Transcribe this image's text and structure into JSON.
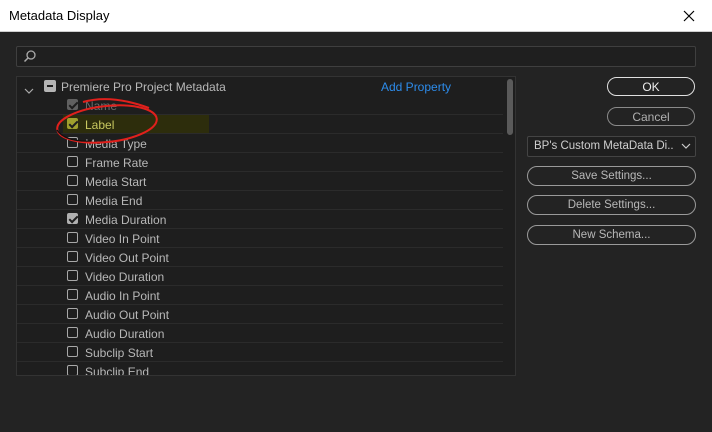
{
  "window": {
    "title": "Metadata Display"
  },
  "search": {
    "placeholder": "",
    "value": ""
  },
  "group": {
    "label": "Premiere Pro Project Metadata",
    "add_property": "Add Property"
  },
  "fields": [
    {
      "label": "Name",
      "checked": true,
      "dim": true
    },
    {
      "label": "Label",
      "checked": true,
      "highlight": true
    },
    {
      "label": "Media Type",
      "checked": false
    },
    {
      "label": "Frame Rate",
      "checked": false
    },
    {
      "label": "Media Start",
      "checked": false
    },
    {
      "label": "Media End",
      "checked": false
    },
    {
      "label": "Media Duration",
      "checked": true
    },
    {
      "label": "Video In Point",
      "checked": false
    },
    {
      "label": "Video Out Point",
      "checked": false
    },
    {
      "label": "Video Duration",
      "checked": false
    },
    {
      "label": "Audio In Point",
      "checked": false
    },
    {
      "label": "Audio Out Point",
      "checked": false
    },
    {
      "label": "Audio Duration",
      "checked": false
    },
    {
      "label": "Subclip Start",
      "checked": false
    },
    {
      "label": "Subclip End",
      "checked": false
    }
  ],
  "buttons": {
    "ok": "OK",
    "cancel": "Cancel",
    "save_settings": "Save Settings...",
    "delete_settings": "Delete Settings...",
    "new_schema": "New Schema..."
  },
  "preset": {
    "selected": "BP's Custom MetaData Di..."
  },
  "colors": {
    "background": "#232323",
    "accent": "#2d8ceb",
    "annotation_red": "#e0201c"
  }
}
